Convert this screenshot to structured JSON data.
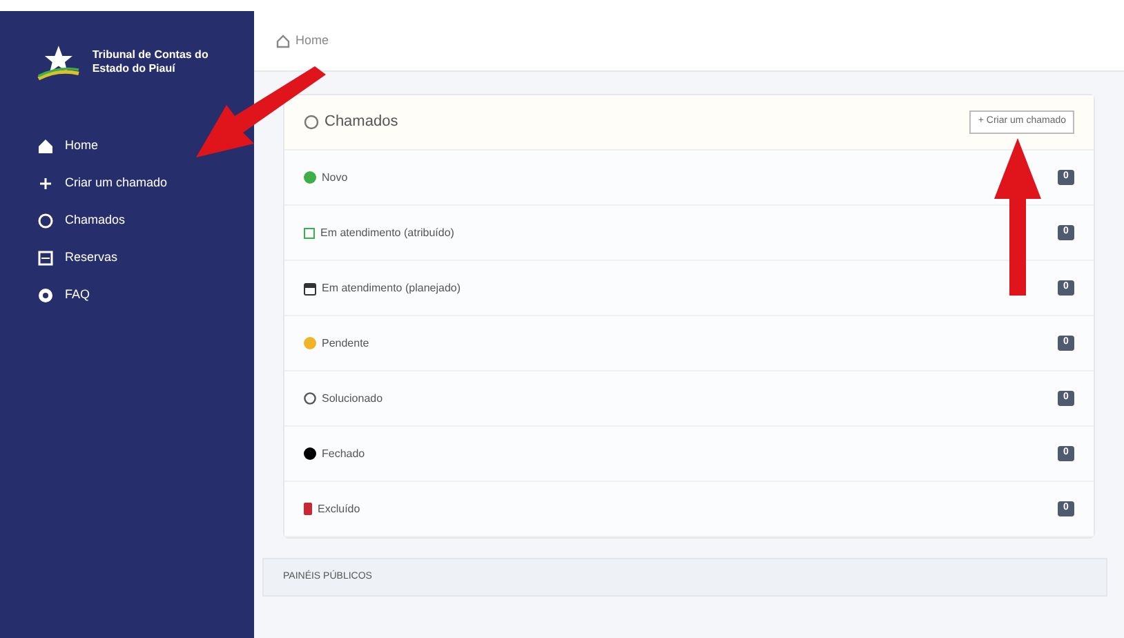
{
  "sidebar": {
    "logo_text": "Tribunal de Contas do Estado do Piauí",
    "items": [
      {
        "label": "Home",
        "kind": "home"
      },
      {
        "label": "Criar um chamado",
        "kind": "create"
      },
      {
        "label": "Chamados",
        "kind": "tickets"
      },
      {
        "label": "Reservas",
        "kind": "bookings"
      },
      {
        "label": "FAQ",
        "kind": "faq"
      }
    ]
  },
  "breadcrumb": "Home",
  "card": {
    "title": "Chamados",
    "create_button": "+ Criar um chamado",
    "rows": [
      {
        "label": "Novo",
        "kind": "dot",
        "color": "#3fae49",
        "count": "0"
      },
      {
        "label": "Em atendimento (atribuído)",
        "kind": "square",
        "color": "#3fae49",
        "count": "0"
      },
      {
        "label": "Em atendimento (planejado)",
        "kind": "calendar",
        "count": "0"
      },
      {
        "label": "Pendente",
        "kind": "dot",
        "color": "#f0b429",
        "count": "0"
      },
      {
        "label": "Solucionado",
        "kind": "circle",
        "count": "0"
      },
      {
        "label": "Fechado",
        "kind": "dot",
        "color": "#000000",
        "count": "0"
      },
      {
        "label": "Excluído",
        "kind": "block",
        "color": "#c62834",
        "count": "0"
      }
    ]
  },
  "footer": "PAINÉIS PÚBLICOS"
}
